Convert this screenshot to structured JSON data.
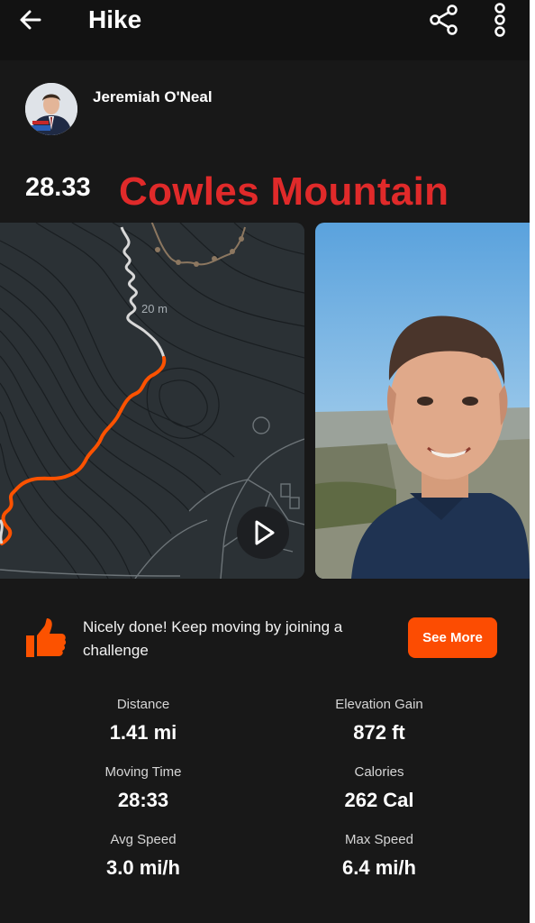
{
  "header": {
    "title": "Hike",
    "back_icon": "arrow-left-icon",
    "share_icon": "share-icon",
    "more_icon": "more-vertical-icon"
  },
  "athlete": {
    "name": "Jeremiah O'Neal"
  },
  "activity": {
    "number": "28.33",
    "name": "Cowles Mountain",
    "name_color": "#e02a2a"
  },
  "map": {
    "contour_label": "20 m",
    "route_color": "#fc5200",
    "play_icon": "play-icon"
  },
  "promo": {
    "icon": "thumbs-up-icon",
    "text": "Nicely done! Keep moving by joining a challenge",
    "button_label": "See More",
    "button_color": "#fc4c02"
  },
  "stats": [
    {
      "label": "Distance",
      "value": "1.41 mi"
    },
    {
      "label": "Elevation Gain",
      "value": "872 ft"
    },
    {
      "label": "Moving Time",
      "value": "28:33"
    },
    {
      "label": "Calories",
      "value": "262 Cal"
    },
    {
      "label": "Avg Speed",
      "value": "3.0 mi/h"
    },
    {
      "label": "Max Speed",
      "value": "6.4 mi/h"
    }
  ]
}
